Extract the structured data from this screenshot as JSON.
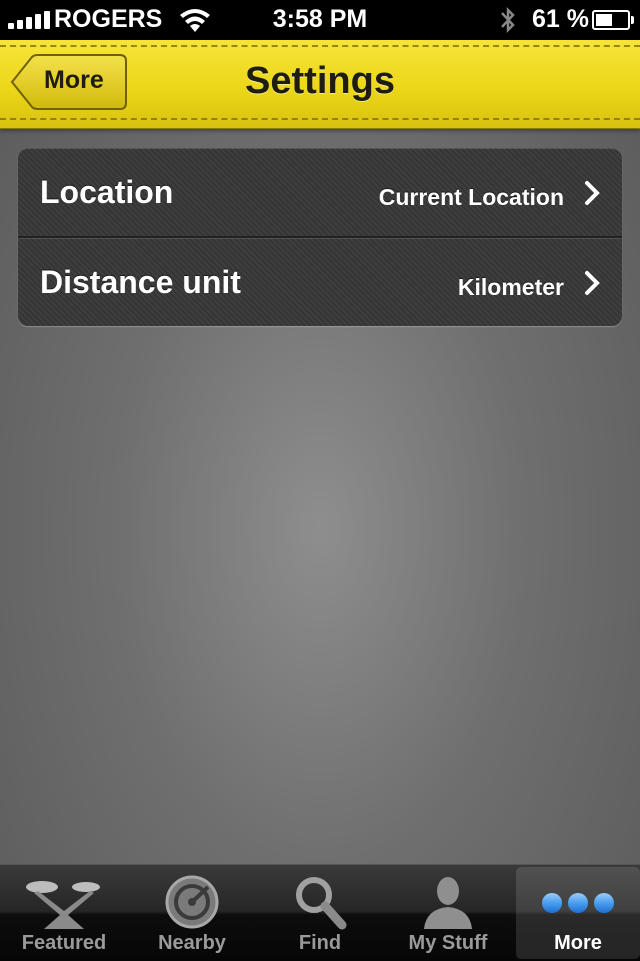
{
  "status_bar": {
    "carrier": "ROGERS",
    "time": "3:58 PM",
    "battery_percent": "61 %",
    "battery_level": 0.61
  },
  "nav": {
    "back_label": "More",
    "title": "Settings"
  },
  "settings": {
    "rows": [
      {
        "label": "Location",
        "value": "Current Location"
      },
      {
        "label": "Distance unit",
        "value": "Kilometer"
      }
    ]
  },
  "tabs": [
    {
      "label": "Featured",
      "icon": "featured-icon",
      "active": false
    },
    {
      "label": "Nearby",
      "icon": "radar-icon",
      "active": false
    },
    {
      "label": "Find",
      "icon": "search-icon",
      "active": false
    },
    {
      "label": "My Stuff",
      "icon": "person-icon",
      "active": false
    },
    {
      "label": "More",
      "icon": "more-dots-icon",
      "active": true
    }
  ],
  "colors": {
    "nav_yellow": "#ecd719",
    "tab_active_dot": "#4a9ef0"
  }
}
